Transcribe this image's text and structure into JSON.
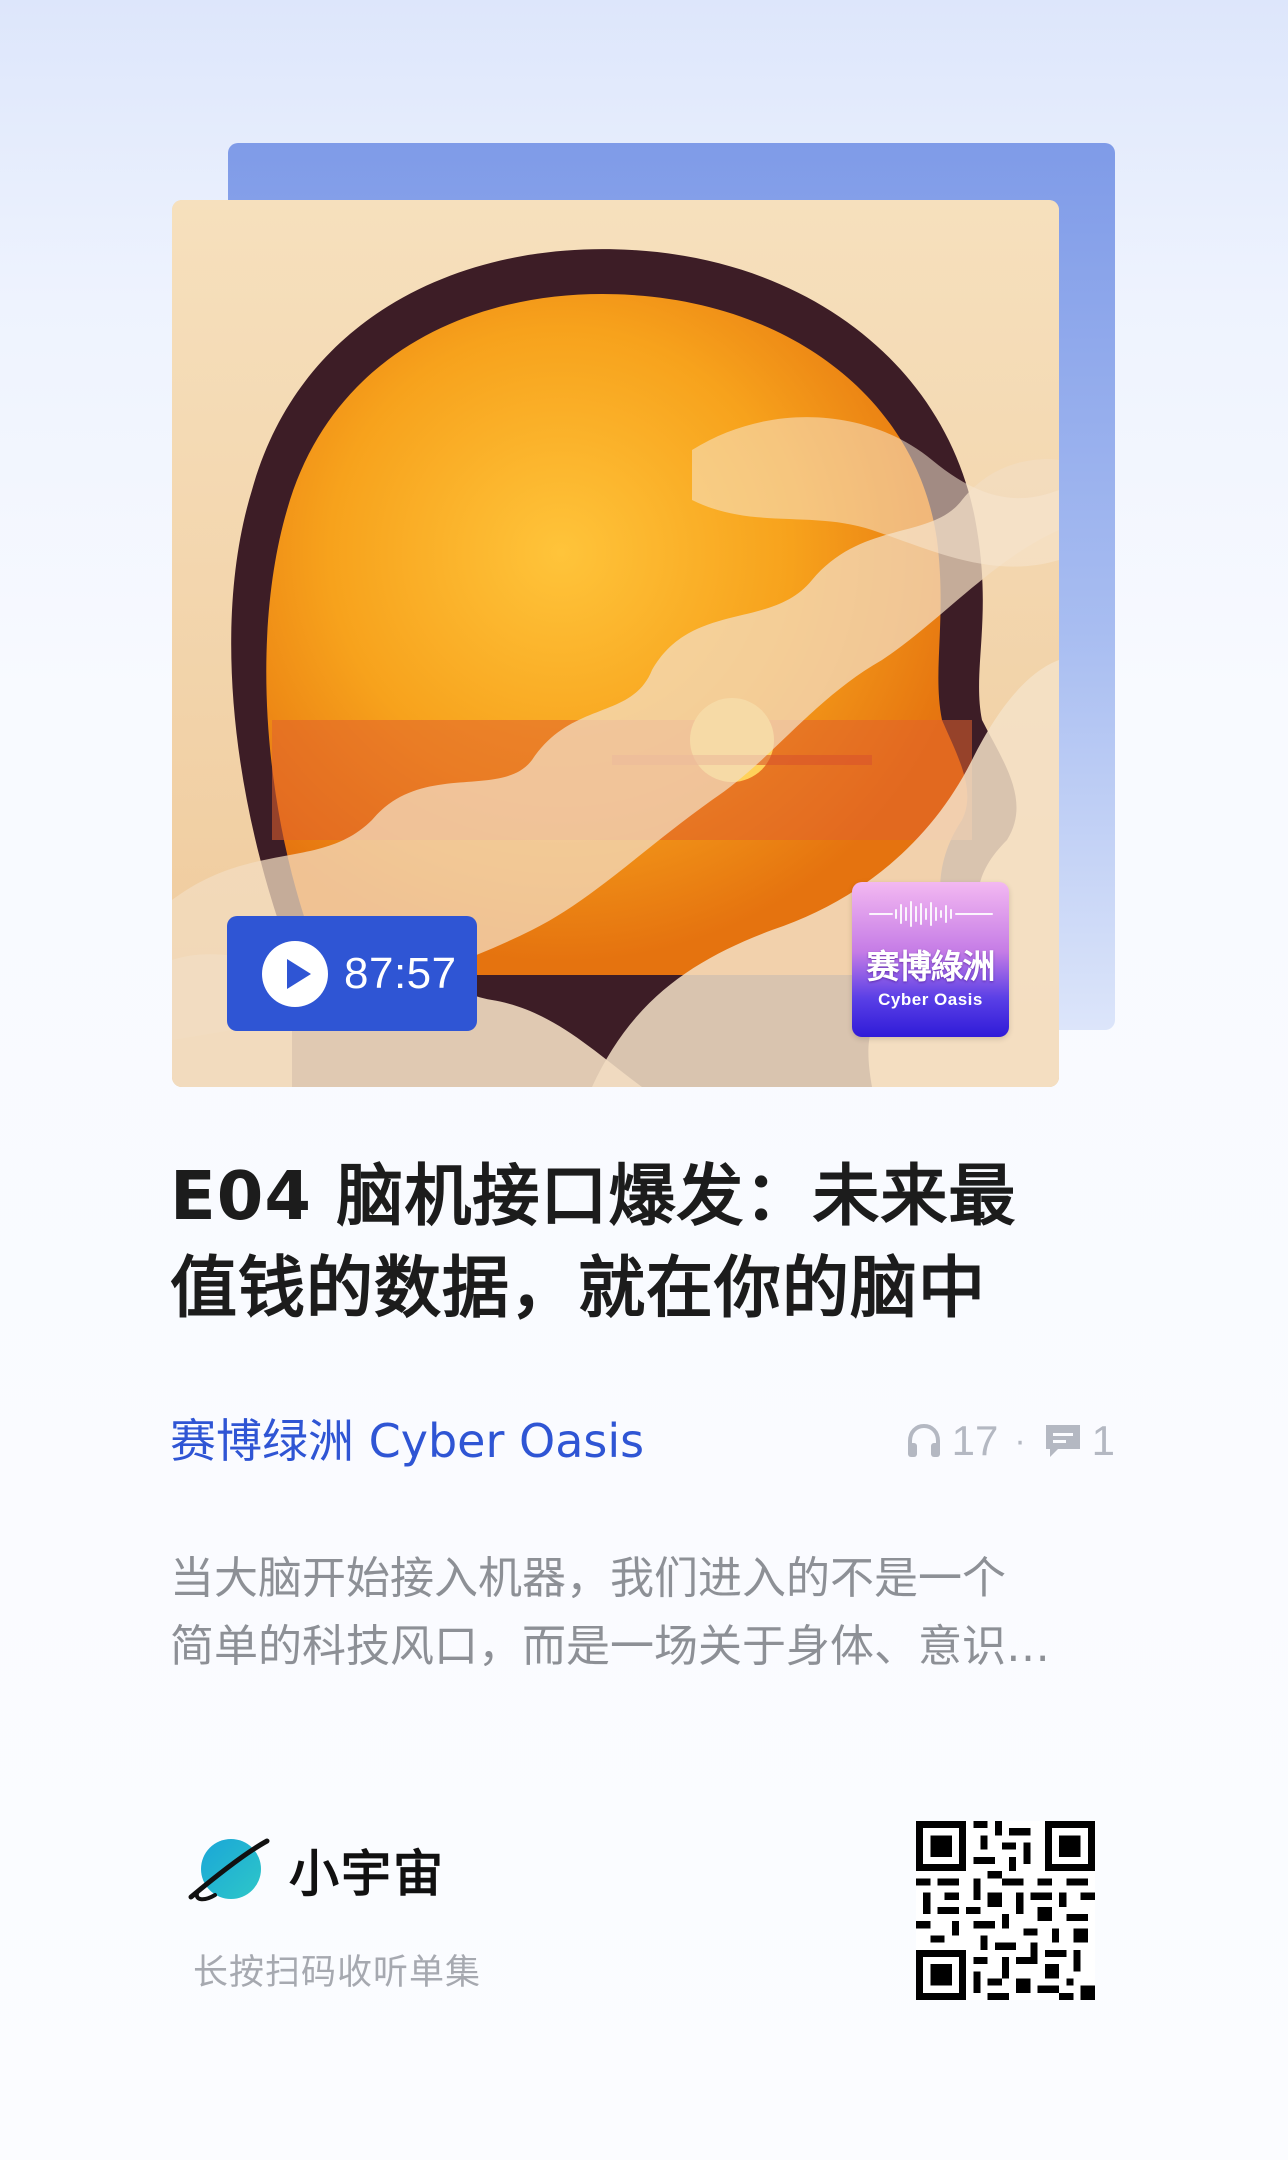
{
  "episode": {
    "cover_duration": "87:57",
    "title_line1": "E04 脑机接口爆发：未来最",
    "title_line2": "值钱的数据，就在你的脑中",
    "podcast_name": "赛博绿洲 Cyber Oasis",
    "listen_count": "17",
    "comment_count": "1",
    "description_line1": "当大脑开始接入机器，我们进入的不是一个",
    "description_line2": "简单的科技风口，而是一场关于身体、意识…"
  },
  "badge": {
    "title_cn": "赛博綠洲",
    "title_en": "Cyber Oasis"
  },
  "footer": {
    "brand_name": "小宇宙",
    "hint": "长按扫码收听单集"
  },
  "icons": {
    "play": "play-icon",
    "headphones": "headphones-icon",
    "comment": "comment-icon",
    "logo": "planet-logo-icon",
    "qr": "qr-code"
  },
  "colors": {
    "accent": "#2f55d4",
    "title": "#1c1c1c",
    "muted": "#8d9096"
  }
}
